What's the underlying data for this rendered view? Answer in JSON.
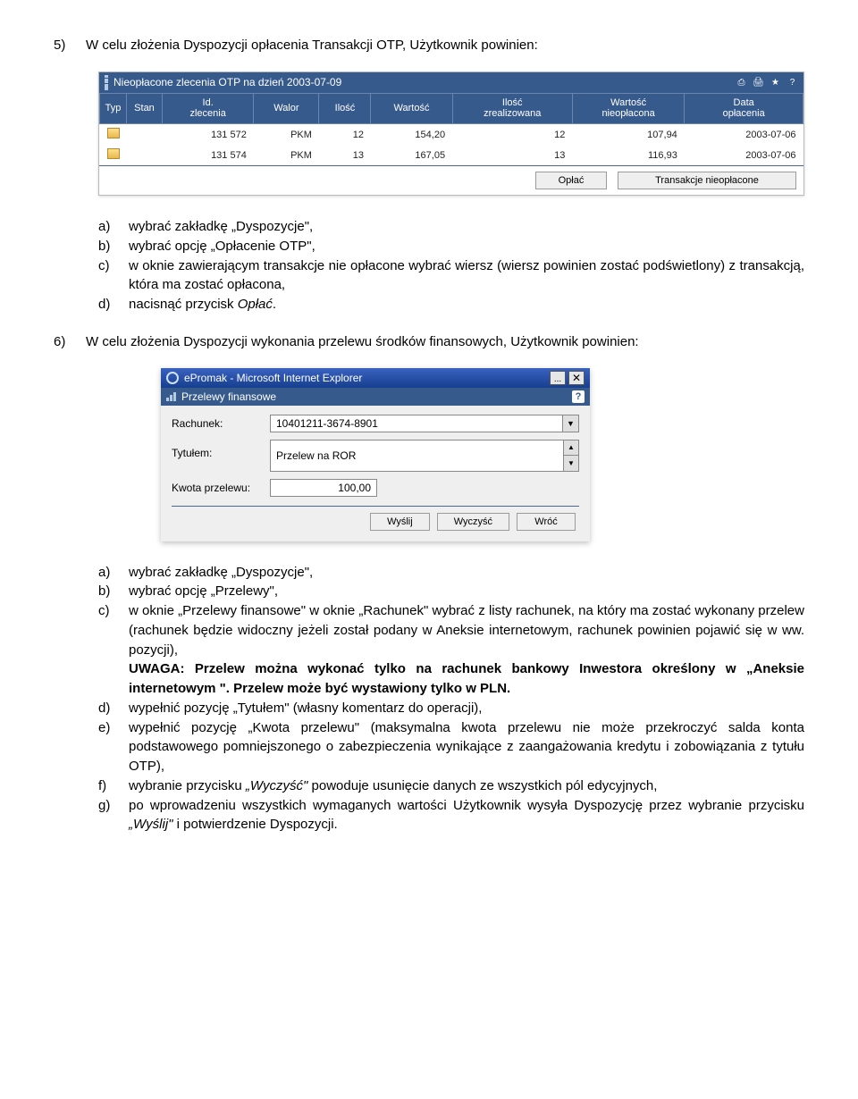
{
  "section5": {
    "num": "5)",
    "text": "W celu złożenia Dyspozycji opłacenia Transakcji OTP, Użytkownik powinien:"
  },
  "shot1": {
    "title": "Nieopłacone zlecenia OTP na dzień 2003-07-09",
    "icons": {
      "print": "⎙",
      "printer": "🖨",
      "star": "★",
      "help": "?"
    },
    "headers": {
      "typ": "Typ",
      "stan": "Stan",
      "id": "Id.\nzlecenia",
      "walor": "Walor",
      "ilosc": "Ilość",
      "wartosc": "Wartość",
      "iloscz": "Ilość\nzrealizowana",
      "wartn": "Wartość\nnieopłacona",
      "data": "Data\nopłacenia"
    },
    "rows": [
      {
        "id": "131 572",
        "walor": "PKM",
        "ilosc": "12",
        "wartosc": "154,20",
        "iloscz": "12",
        "wartn": "107,94",
        "data": "2003-07-06"
      },
      {
        "id": "131 574",
        "walor": "PKM",
        "ilosc": "13",
        "wartosc": "167,05",
        "iloscz": "13",
        "wartn": "116,93",
        "data": "2003-07-06"
      }
    ],
    "btn_oplac": "Opłać",
    "btn_trans": "Transakcje nieopłacone"
  },
  "list5": {
    "a": {
      "lbl": "a)",
      "txt": "wybrać zakładkę „Dyspozycje\","
    },
    "b": {
      "lbl": "b)",
      "txt": "wybrać opcję „Opłacenie OTP\","
    },
    "c": {
      "lbl": "c)",
      "txt": "w oknie zawierającym transakcje nie opłacone wybrać wiersz (wiersz powinien zostać podświetlony) z transakcją, która ma zostać opłacona,"
    },
    "d": {
      "lbl": "d)",
      "pre": "nacisnąć przycisk ",
      "it": "Opłać",
      "post": "."
    }
  },
  "section6": {
    "num": "6)",
    "text": "W celu złożenia Dyspozycji wykonania przelewu środków finansowych, Użytkownik powinien:"
  },
  "shot2": {
    "ie_title": "ePromak - Microsoft Internet Explorer",
    "sub_title": "Przelewy finansowe",
    "help": "?",
    "lbl_rach": "Rachunek:",
    "val_rach": "10401211-3674-8901",
    "lbl_tyt": "Tytułem:",
    "val_tyt": "Przelew na ROR",
    "lbl_kwota": "Kwota przelewu:",
    "val_kwota": "100,00",
    "btn_wyslij": "Wyślij",
    "btn_wyczysc": "Wyczyść",
    "btn_wroc": "Wróć"
  },
  "list6": {
    "a": {
      "lbl": "a)",
      "txt": "wybrać zakładkę „Dyspozycje\","
    },
    "b": {
      "lbl": "b)",
      "txt": "wybrać opcję „Przelewy\","
    },
    "c": {
      "lbl": "c)",
      "txt": "w oknie „Przelewy finansowe\" w oknie „Rachunek\" wybrać z listy rachunek, na który ma zostać wykonany przelew (rachunek będzie widoczny jeżeli został podany w Aneksie internetowym, rachunek powinien pojawić się w ww. pozycji),",
      "bold": "UWAGA: Przelew można wykonać tylko na rachunek bankowy Inwestora określony w „Aneksie internetowym \". Przelew może być wystawiony tylko w PLN."
    },
    "d": {
      "lbl": "d)",
      "txt": "wypełnić pozycję „Tytułem\" (własny komentarz do operacji),"
    },
    "e": {
      "lbl": "e)",
      "txt": "wypełnić pozycję „Kwota przelewu\" (maksymalna kwota przelewu nie może przekroczyć salda konta podstawowego pomniejszonego o zabezpieczenia wynikające z zaangażowania kredytu i zobowiązania z tytułu OTP),"
    },
    "f": {
      "lbl": "f)",
      "pre": "wybranie przycisku ",
      "it": "„Wyczyść\"",
      "post": " powoduje usunięcie danych ze wszystkich pól edycyjnych,"
    },
    "g": {
      "lbl": "g)",
      "pre": "po wprowadzeniu wszystkich wymaganych wartości Użytkownik wysyła Dyspozycję przez wybranie przycisku ",
      "it": "„Wyślij\"",
      "post": " i potwierdzenie Dyspozycji."
    }
  }
}
